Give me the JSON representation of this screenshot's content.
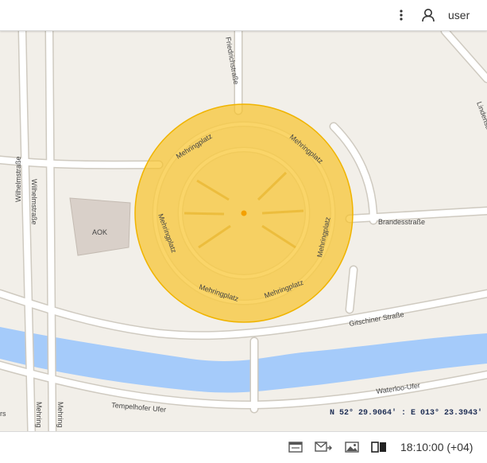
{
  "topbar": {
    "menu_icon": "more-vertical-icon",
    "user_icon": "user-icon",
    "user_label": "user"
  },
  "map": {
    "street_labels": {
      "friedrichstrasse": "Friedrichstraße",
      "lindenstrasse": "Lindenstraße",
      "wilhelmstrasse_1": "Wilhelmstraße",
      "wilhelmstrasse_2": "Wilhelmstraße",
      "mehringplatz_1": "Mehringplatz",
      "mehringplatz_2": "Mehringplatz",
      "mehringplatz_3": "Mehringplatz",
      "mehringplatz_4": "Mehringplatz",
      "mehringplatz_5": "Mehringplatz",
      "mehringplatz_6": "Mehringplatz",
      "brandesstrasse": "Brandesstraße",
      "gitschiner": "Gitschiner Straße",
      "tempelhofer": "Tempelhofer Ufer",
      "waterloo": "Waterloo-Ufer",
      "mehring_bottom_1": "Mehring",
      "mehring_bottom_2": "Mehring",
      "cut_left": "rs"
    },
    "building_label": "AOK",
    "circle_color": "#f8c32a",
    "coordinates": "N 52° 29.9064' : E 013° 23.3943'"
  },
  "bottombar": {
    "icons": [
      "message-icon",
      "mail-forward-icon",
      "image-icon",
      "book-icon"
    ],
    "clock": "18:10:00 (+04)"
  }
}
